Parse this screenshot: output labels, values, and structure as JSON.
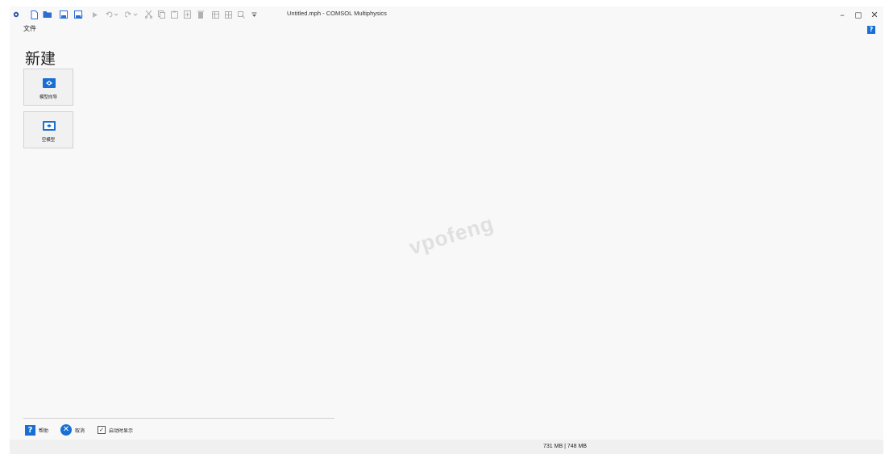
{
  "window": {
    "title": "Untitled.mph - COMSOL Multiphysics",
    "minimize": "–",
    "maximize": "◻",
    "close": "✕"
  },
  "menu": {
    "file": "文件",
    "help_icon": "?"
  },
  "main": {
    "heading": "新建",
    "tiles": [
      {
        "label": "模型向导",
        "icon": "model-wizard-icon"
      },
      {
        "label": "空模型",
        "icon": "blank-model-icon"
      }
    ]
  },
  "watermark": "vpofeng",
  "bottom": {
    "help_label": "帮助",
    "cancel_label": "取消",
    "startup_label": "启动时显示",
    "startup_checked": true
  },
  "status": {
    "memory": "731 MB | 748 MB"
  },
  "colors": {
    "accent": "#1a6fd4",
    "background": "#f8f8f8"
  }
}
